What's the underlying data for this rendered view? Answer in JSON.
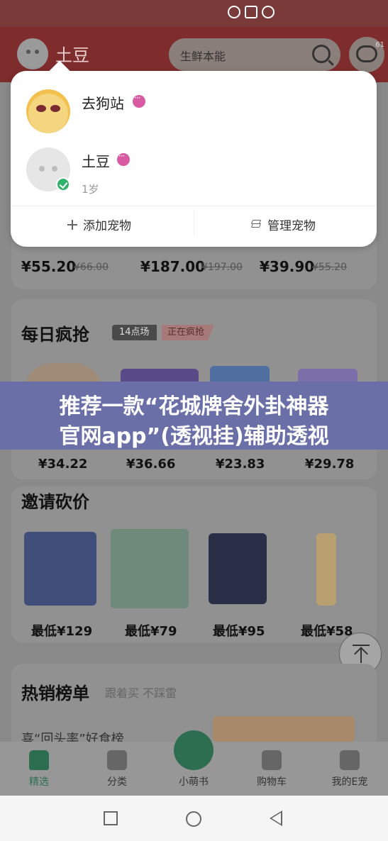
{
  "header": {
    "pet_name": "土豆",
    "search_placeholder": "生鲜本能",
    "message_badge": "61"
  },
  "deal_prices": [
    {
      "price": "¥55.20",
      "old": "¥66.00"
    },
    {
      "price": "¥187.00",
      "old": "¥197.00"
    },
    {
      "price": "¥39.90",
      "old": "¥55.20"
    }
  ],
  "flash_sale": {
    "title": "每日疯抢",
    "time_tag": "14点场",
    "status_tag": "正在疯抢",
    "prices": [
      "¥34.22",
      "¥36.66",
      "¥23.83",
      "¥29.78"
    ]
  },
  "banner": {
    "line1": "推荐一款“花城牌舍外卦神器",
    "line2": "官网app”(透视挂)辅助透视"
  },
  "bargain": {
    "title": "邀请砍价",
    "items": [
      {
        "low_price": "最低¥129"
      },
      {
        "low_price": "最低¥79"
      },
      {
        "low_price": "最低¥95"
      },
      {
        "low_price": "最低¥58"
      }
    ]
  },
  "hot": {
    "title": "热销榜单",
    "subtitle": "跟着买 不踩雷",
    "sub_list": "喜“回头率”好食榜"
  },
  "tabs": [
    {
      "label": "精选"
    },
    {
      "label": "分类"
    },
    {
      "label": "小萌书"
    },
    {
      "label": "购物车"
    },
    {
      "label": "我的E宠"
    }
  ],
  "popup": {
    "pets": [
      {
        "name": "去狗站",
        "age": ""
      },
      {
        "name": "土豆",
        "age": "1岁"
      }
    ],
    "add_label": "添加宠物",
    "manage_label": "管理宠物"
  },
  "colors": {
    "brand_green": "#2d6e51",
    "header_red": "#7f2c2c",
    "banner_blue": "#6b6fa8"
  }
}
